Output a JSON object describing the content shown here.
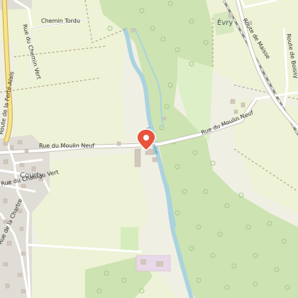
{
  "map": {
    "labels": {
      "chemin_tordu": "Chemin Tordu",
      "rue_chemin_vert": "Rue du Chemin Vert",
      "route_ferte_alais": "Route de la Ferté-Alais",
      "evry": "Évry",
      "route_de_maisse": "Route de Maisse",
      "route_de_boissy": "Route de Boissy",
      "rue_moulin_neuf_west": "Rue du Moulin Neuf",
      "rue_moulin_neuf_east": "Rue du Moulin Neuf",
      "courty": "Courty",
      "rue_chateau_vert": "Rue du Château Vert",
      "rue_chartre": "Rue de la Chartre",
      "river_label": "L'Essonne"
    },
    "marker": {
      "icon": "map-pin-icon",
      "color": "#e8543b"
    },
    "colors": {
      "land": "#f2efe6",
      "farmland": "#eef2d6",
      "forest": "#cfe5b4",
      "forest_dark": "#b9dc9e",
      "water": "#aad3df",
      "residential": "#dedcd8",
      "building": "#d1c7bd",
      "road_major": "#f7e38a",
      "road_major_casing": "#caa94b",
      "road": "#ffffff",
      "road_casing": "#c8c3b8"
    }
  }
}
